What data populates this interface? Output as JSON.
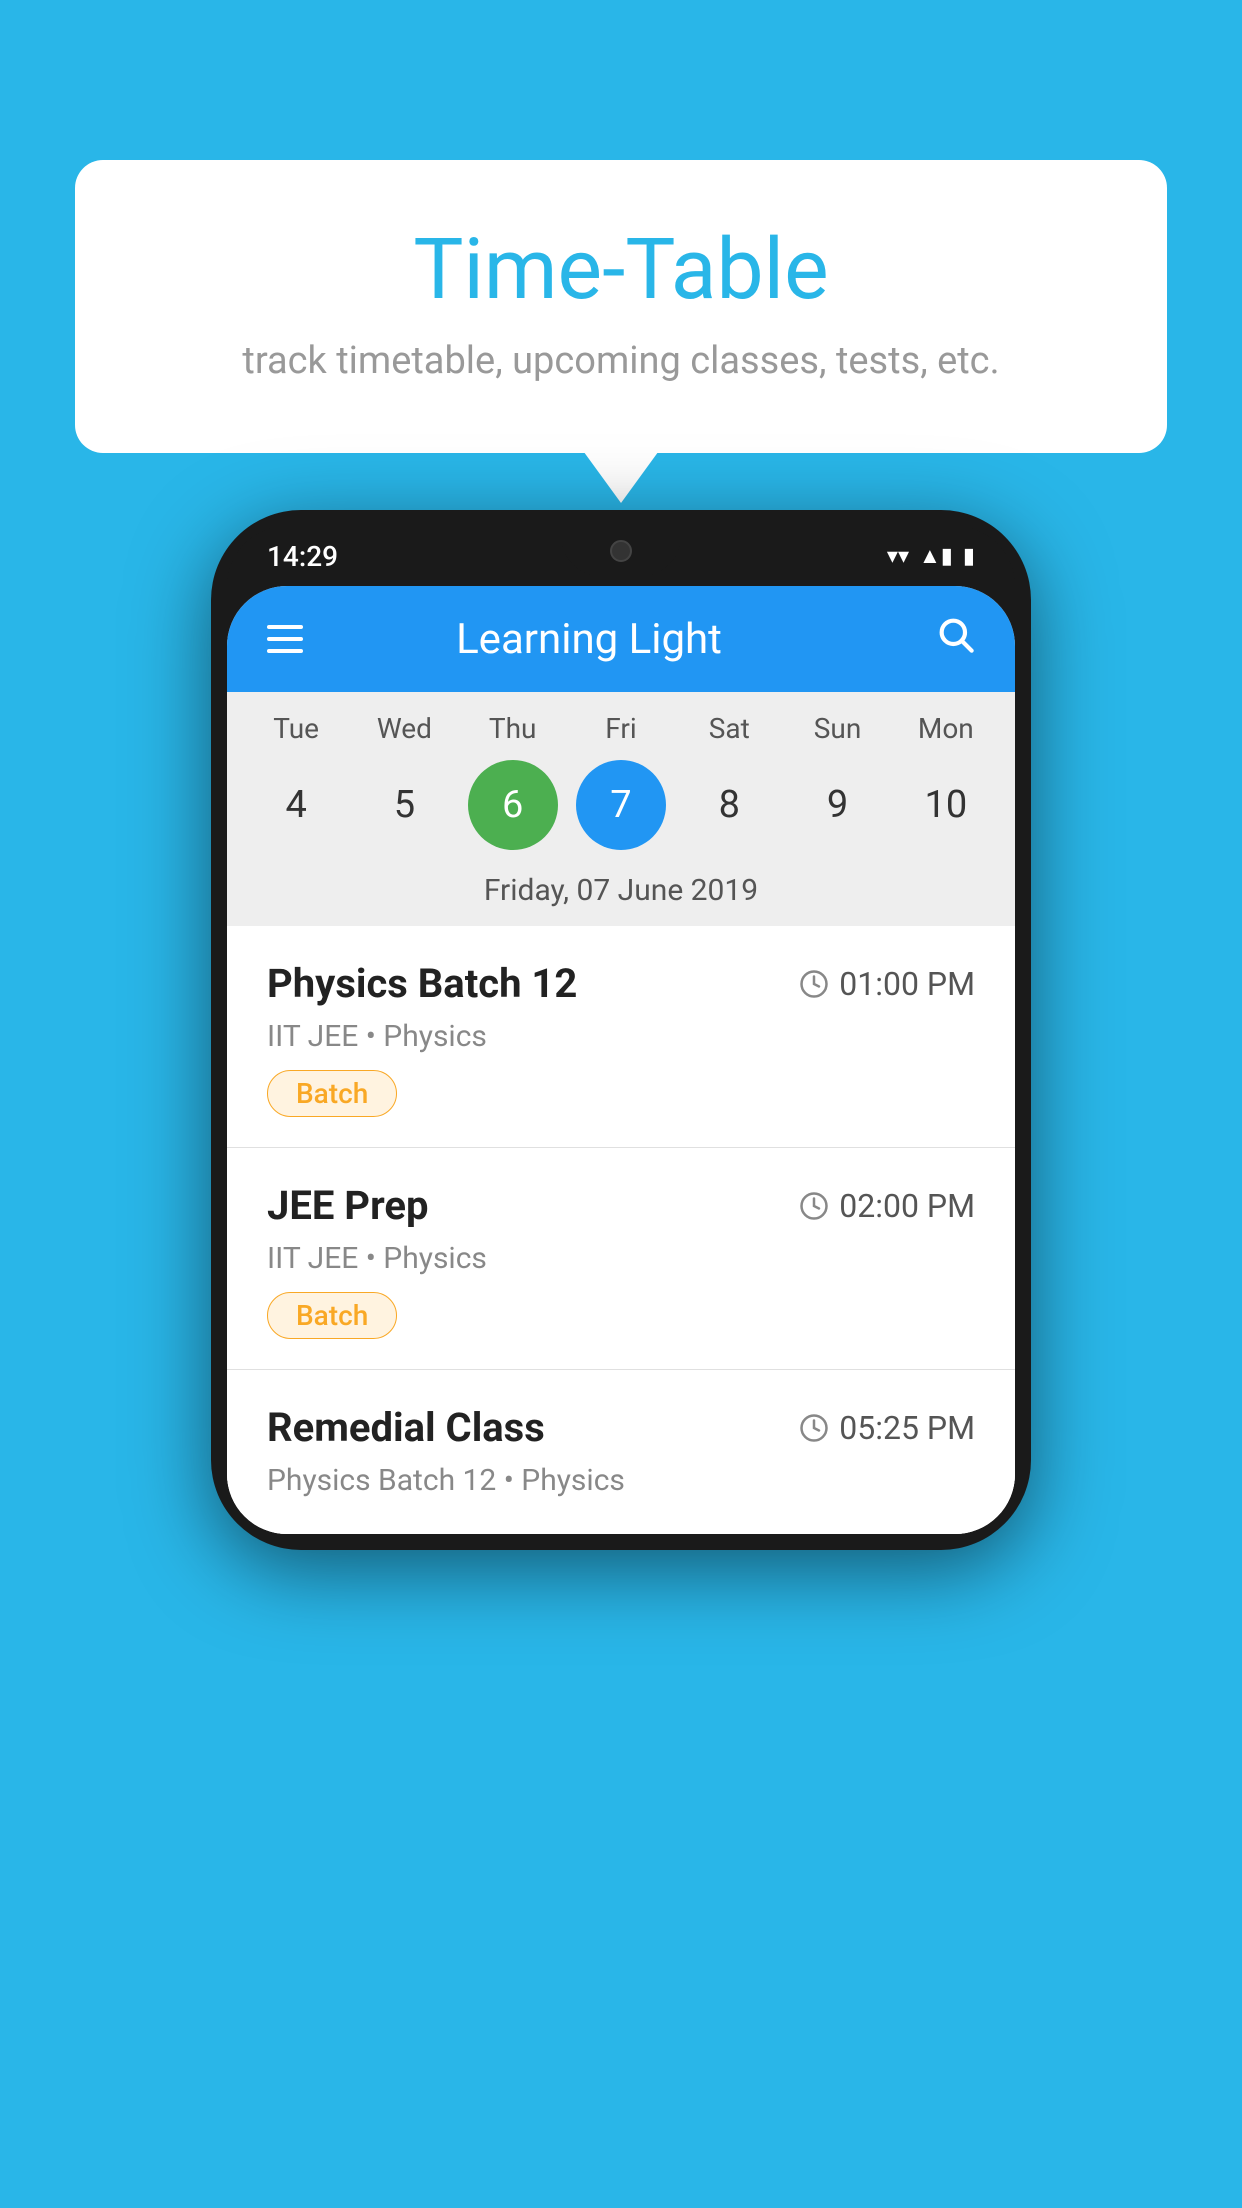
{
  "background_color": "#29b6e8",
  "tooltip": {
    "title": "Time-Table",
    "subtitle": "track timetable, upcoming classes, tests, etc."
  },
  "phone": {
    "status_bar": {
      "time": "14:29",
      "wifi": "▼",
      "signal": "▲",
      "battery": "▮"
    },
    "app_bar": {
      "title": "Learning Light",
      "menu_icon": "menu",
      "search_icon": "search"
    },
    "calendar": {
      "days": [
        {
          "label": "Tue",
          "number": "4"
        },
        {
          "label": "Wed",
          "number": "5"
        },
        {
          "label": "Thu",
          "number": "6",
          "state": "today"
        },
        {
          "label": "Fri",
          "number": "7",
          "state": "selected"
        },
        {
          "label": "Sat",
          "number": "8"
        },
        {
          "label": "Sun",
          "number": "9"
        },
        {
          "label": "Mon",
          "number": "10"
        }
      ],
      "selected_date_label": "Friday, 07 June 2019"
    },
    "schedule": [
      {
        "title": "Physics Batch 12",
        "time": "01:00 PM",
        "sub": "IIT JEE • Physics",
        "tag": "Batch"
      },
      {
        "title": "JEE Prep",
        "time": "02:00 PM",
        "sub": "IIT JEE • Physics",
        "tag": "Batch"
      },
      {
        "title": "Remedial Class",
        "time": "05:25 PM",
        "sub": "Physics Batch 12 • Physics",
        "tag": null
      }
    ]
  }
}
